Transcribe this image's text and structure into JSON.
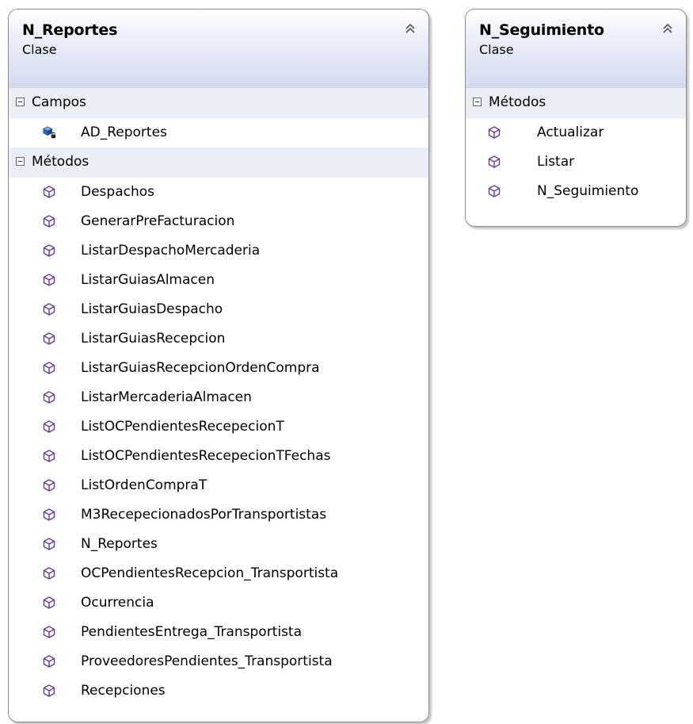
{
  "classes": [
    {
      "name": "N_Reportes",
      "stereotype": "Clase",
      "fields_label": "Campos",
      "fields": [
        "AD_Reportes"
      ],
      "methods_label": "Métodos",
      "methods": [
        "Despachos",
        "GenerarPreFacturacion",
        "ListarDespachoMercaderia",
        "ListarGuiasAlmacen",
        "ListarGuiasDespacho",
        "ListarGuiasRecepcion",
        "ListarGuiasRecepcionOrdenCompra",
        "ListarMercaderiaAlmacen",
        "ListOCPendientesRecepecionT",
        "ListOCPendientesRecepecionTFechas",
        "ListOrdenCompraT",
        "M3RecepecionadosPorTransportistas",
        "N_Reportes",
        "OCPendientesRecepcion_Transportista",
        "Ocurrencia",
        "PendientesEntrega_Transportista",
        "ProveedoresPendientes_Transportista",
        "Recepciones"
      ]
    },
    {
      "name": "N_Seguimiento",
      "stereotype": "Clase",
      "methods_label": "Métodos",
      "methods": [
        "Actualizar",
        "Listar",
        "N_Seguimiento"
      ]
    }
  ],
  "icons": {
    "collapse": "double-chevron-up-icon",
    "section_toggle": "minus-box-icon",
    "field": "private-field-icon",
    "method": "method-cube-icon"
  },
  "colors": {
    "border": "#8a8a8a",
    "header_gradient_end": "#d4dbef",
    "section_bg": "#eaeef6",
    "method_icon": "#6a3a9a",
    "field_icon": "#2f6db5"
  }
}
